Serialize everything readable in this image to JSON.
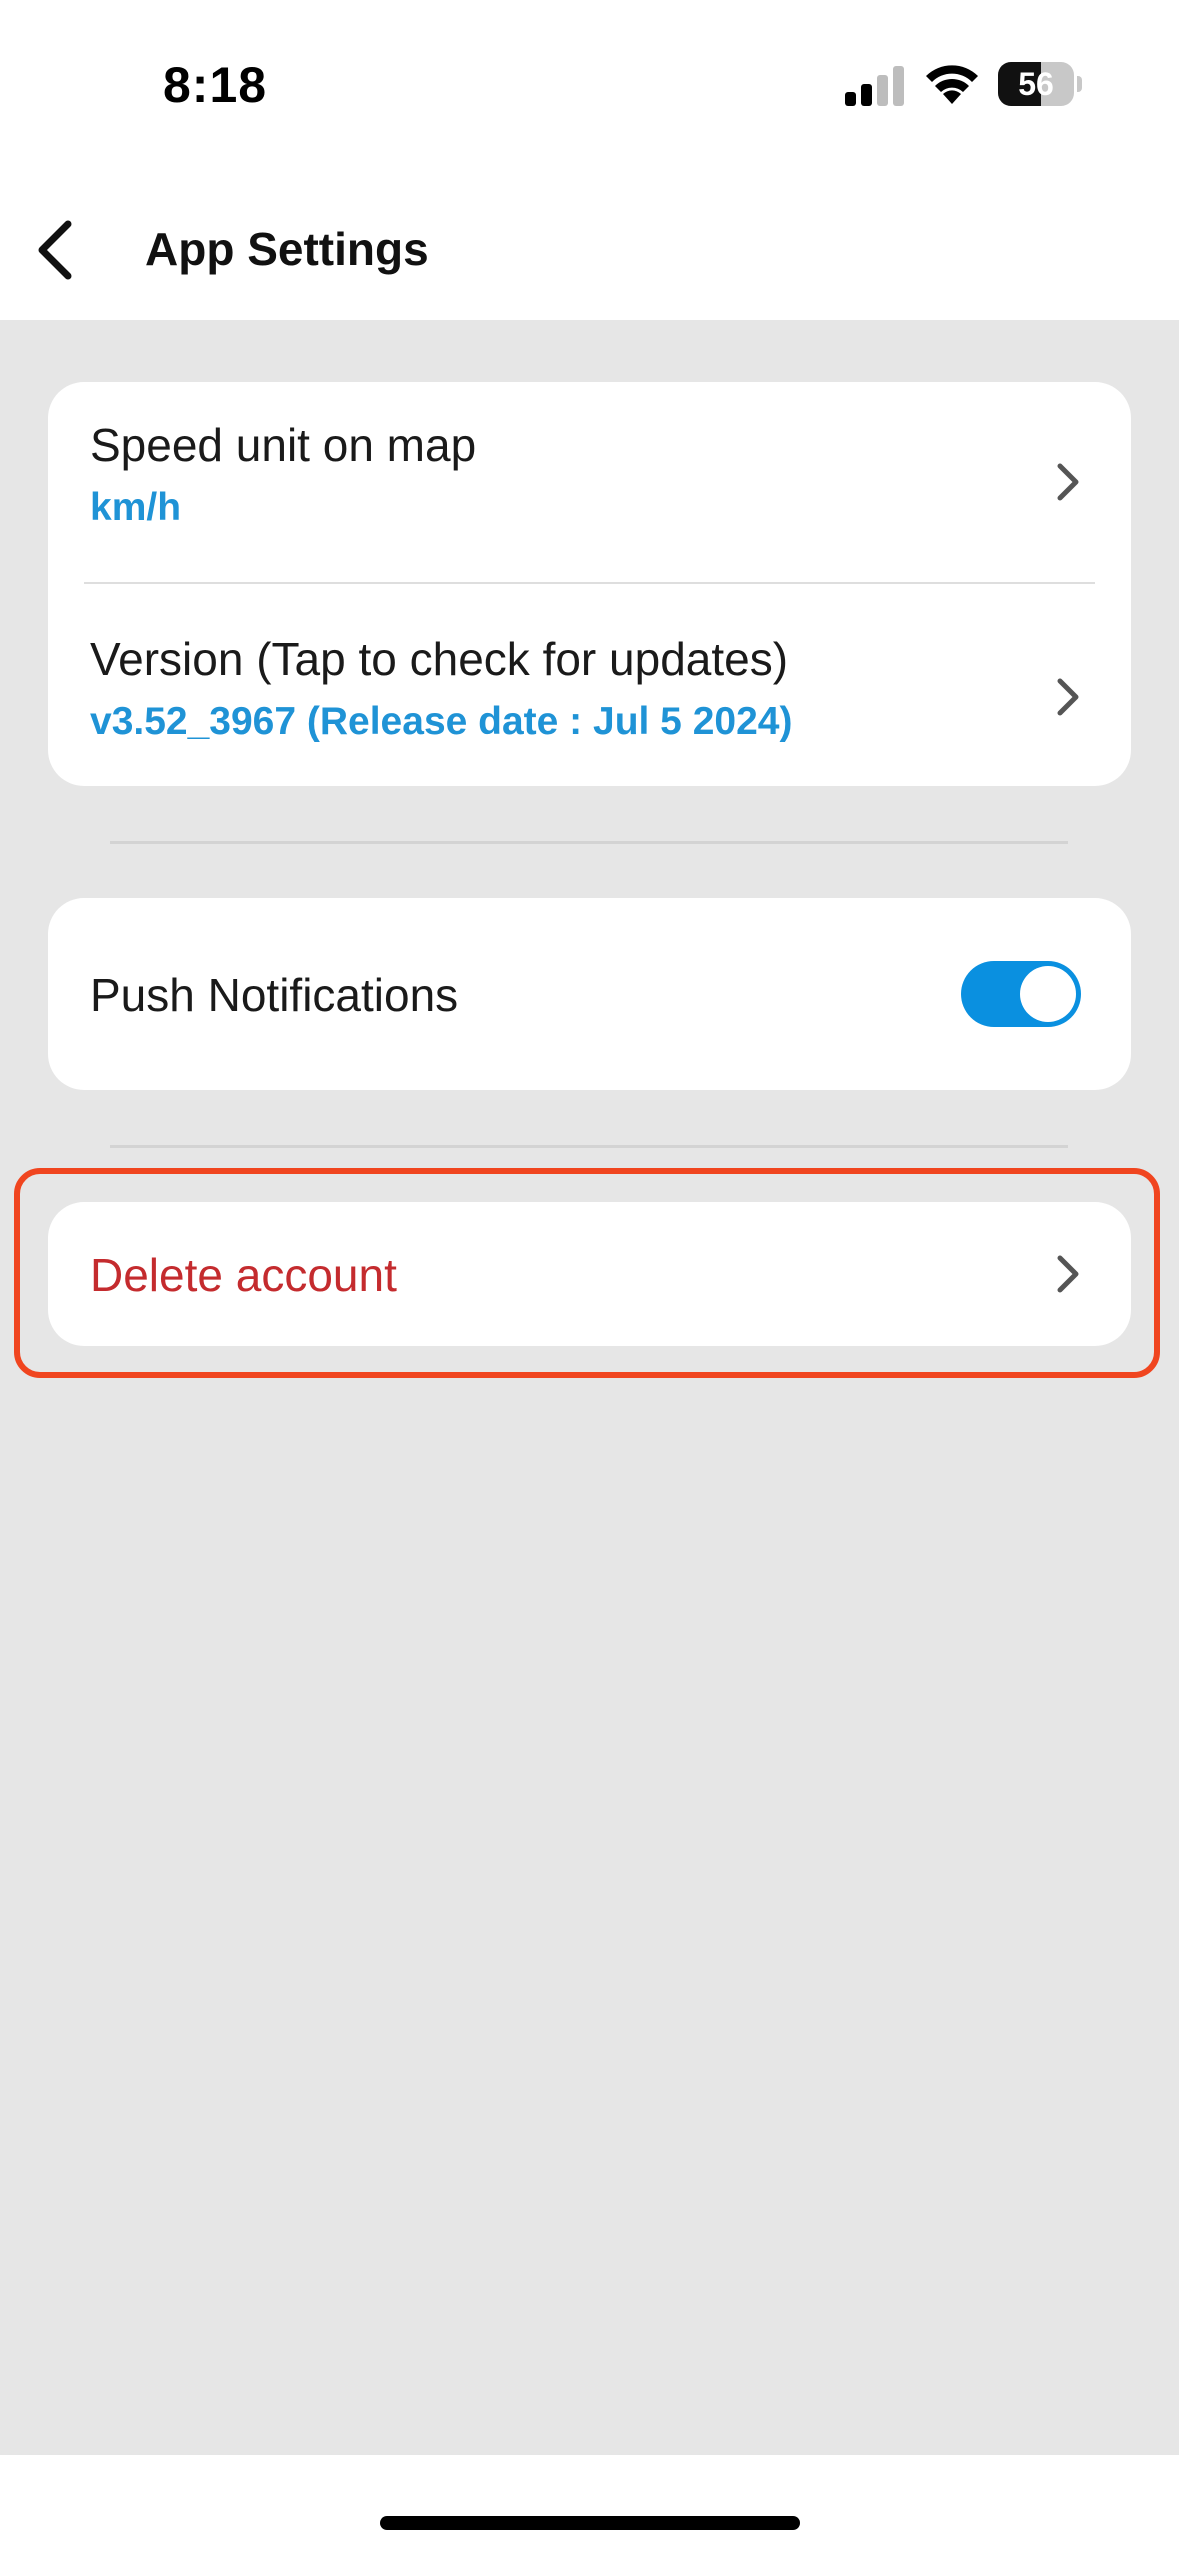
{
  "status_bar": {
    "time": "8:18",
    "battery_level": "56",
    "battery_fraction": 0.56,
    "signal_bars_active": 2,
    "signal_bars_total": 4
  },
  "nav": {
    "title": "App Settings",
    "back_icon": "chevron-left-icon"
  },
  "settings": {
    "speed_unit": {
      "title": "Speed unit on map",
      "value": "km/h"
    },
    "version": {
      "title": "Version (Tap to check for updates)",
      "value": "v3.52_3967 (Release date : Jul  5 2024)"
    },
    "push_notifications": {
      "title": "Push Notifications",
      "enabled": true
    },
    "delete_account": {
      "title": "Delete account"
    }
  },
  "colors": {
    "accent": "#1f93d6",
    "toggle_on": "#0a90e0",
    "danger": "#c42b2e",
    "highlight": "#f0451f",
    "background": "#e6e6e6"
  }
}
